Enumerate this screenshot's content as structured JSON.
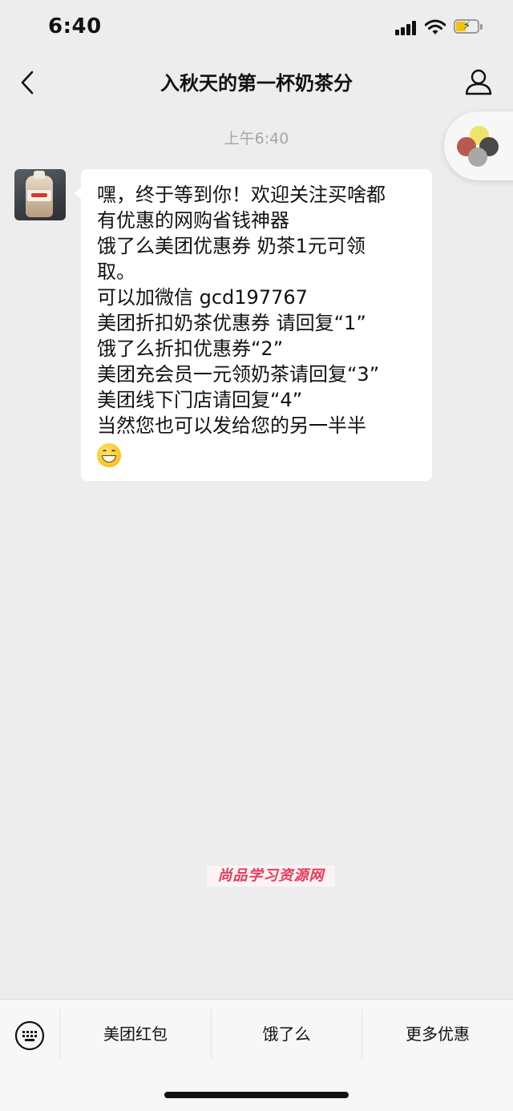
{
  "status_bar": {
    "time": "6:40"
  },
  "chat": {
    "title": "入秋天的第一杯奶茶分"
  },
  "conversation": {
    "timestamp": "上午6:40",
    "message": {
      "lines": [
        "嘿，终于等到你！欢迎关注买啥都",
        "有优惠的网购省钱神器",
        "饿了么美团优惠券 奶茶1元可领",
        "取。",
        "可以加微信 gcd197767",
        "美团折扣奶茶优惠券 请回复“1”",
        "饿了么折扣优惠券“2”",
        "美团充会员一元领奶茶请回复“3”",
        "美团线下门店请回复“4”",
        "当然您也可以发给您的另一半半"
      ],
      "emoji": "grin-emoji"
    }
  },
  "watermark": "尚品学习资源网",
  "menu": {
    "items": [
      "美团红包",
      "饿了么",
      "更多优惠"
    ]
  },
  "colors": {
    "background": "#ededed",
    "bubble": "#ffffff",
    "timestamp": "#a6a6a6",
    "watermark": "#e83a5a",
    "battery": "#f2c200"
  }
}
